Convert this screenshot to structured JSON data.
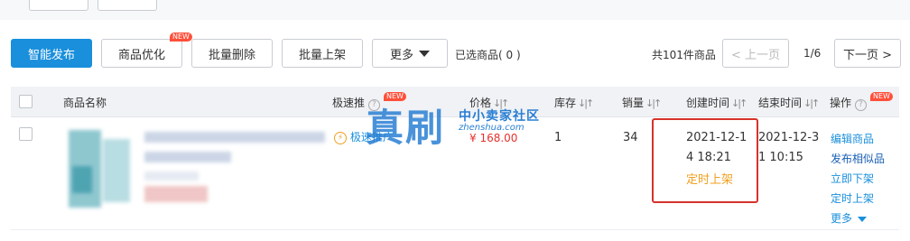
{
  "toolbar": {
    "smart_publish": "智能发布",
    "optimize": "商品优化",
    "optimize_badge": "NEW",
    "batch_delete": "批量删除",
    "batch_list": "批量上架",
    "more": "更多",
    "selected_count": "已选商品( 0 )"
  },
  "pager": {
    "total": "共101件商品",
    "prev": "< 上一页",
    "page": "1/6",
    "next": "下一页 >"
  },
  "table": {
    "columns": {
      "name": "商品名称",
      "boost": "极速推",
      "boost_badge": "NEW",
      "price": "价格",
      "stock": "库存",
      "sales": "销量",
      "created": "创建时间",
      "ended": "结束时间",
      "actions": "操作",
      "actions_badge": "NEW"
    },
    "row": {
      "boost_label": "极速推广",
      "price": "¥ 168.00",
      "stock": "1",
      "sales": "34",
      "created_line1": "2021-12-1",
      "created_line2": "4 18:21",
      "created_status": "定时上架",
      "ended_line1": "2021-12-3",
      "ended_line2": "1 10:15",
      "actions": [
        "编辑商品",
        "发布相似品",
        "立即下架",
        "定时上架",
        "更多"
      ]
    }
  },
  "watermark": {
    "big": "真刷",
    "sub": "中小卖家社区",
    "url": "zhenshua.com"
  },
  "colors": {
    "primary": "#1a8fdc",
    "badge": "#ff4f3a",
    "price": "#e5322d",
    "status": "#f0a020",
    "highlight_frame": "#d6322a"
  }
}
